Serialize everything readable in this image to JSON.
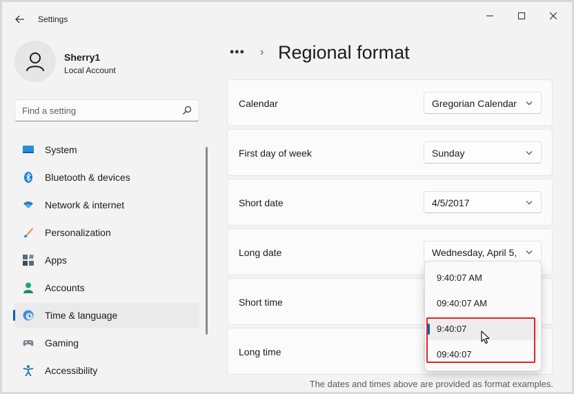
{
  "app": {
    "title": "Settings"
  },
  "user": {
    "name": "Sherry1",
    "account_type": "Local Account"
  },
  "search": {
    "placeholder": "Find a setting"
  },
  "nav": {
    "items": [
      {
        "label": "System",
        "icon": "system-icon"
      },
      {
        "label": "Bluetooth & devices",
        "icon": "bluetooth-icon"
      },
      {
        "label": "Network & internet",
        "icon": "network-icon"
      },
      {
        "label": "Personalization",
        "icon": "brush-icon"
      },
      {
        "label": "Apps",
        "icon": "apps-icon"
      },
      {
        "label": "Accounts",
        "icon": "accounts-icon"
      },
      {
        "label": "Time & language",
        "icon": "time-language-icon",
        "active": true
      },
      {
        "label": "Gaming",
        "icon": "gaming-icon"
      },
      {
        "label": "Accessibility",
        "icon": "accessibility-icon"
      }
    ]
  },
  "header": {
    "breadcrumb_more": "•••",
    "separator": "›",
    "title": "Regional format"
  },
  "settings": [
    {
      "label": "Calendar",
      "value": "Gregorian Calendar"
    },
    {
      "label": "First day of week",
      "value": "Sunday"
    },
    {
      "label": "Short date",
      "value": "4/5/2017"
    },
    {
      "label": "Long date",
      "value": "Wednesday, April 5,"
    },
    {
      "label": "Short time",
      "value": ""
    },
    {
      "label": "Long time",
      "value": ""
    }
  ],
  "dropdown": {
    "options": [
      "9:40:07 AM",
      "09:40:07 AM",
      "9:40:07",
      "09:40:07"
    ],
    "selected_index": 2
  },
  "footnote": "The dates and times above are provided as format examples.",
  "colors": {
    "accent": "#005fb8",
    "highlight": "#e02424"
  }
}
